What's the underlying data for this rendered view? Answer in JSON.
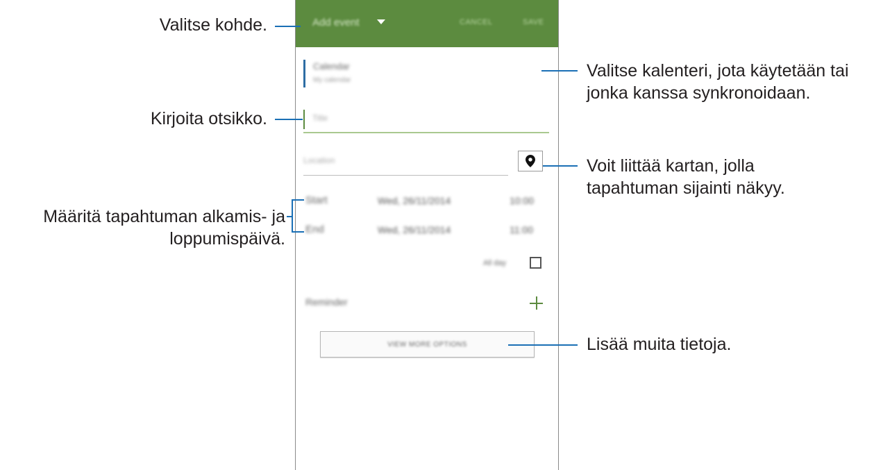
{
  "screen": {
    "app_bar": {
      "title": "Add event",
      "cancel_label": "CANCEL",
      "save_label": "SAVE",
      "color": "#5c8b3f"
    },
    "calendar": {
      "label": "Calendar",
      "value": "My calendar"
    },
    "title_field": {
      "placeholder": "Title"
    },
    "location_field": {
      "placeholder": "Location"
    },
    "start": {
      "label": "Start",
      "date": "Wed, 26/11/2014",
      "time": "10:00"
    },
    "end": {
      "label": "End",
      "date": "Wed, 26/11/2014",
      "time": "11:00"
    },
    "all_day_label": "All day",
    "reminder_label": "Reminder",
    "view_more_label": "VIEW MORE OPTIONS"
  },
  "callouts": {
    "select_item": "Valitse kohde.",
    "enter_title": "Kirjoita otsikko.",
    "set_dates_line1": "Määritä tapahtuman alkamis- ja",
    "set_dates_line2": "loppumispäivä.",
    "select_calendar_line1": "Valitse kalenteri, jota käytetään tai",
    "select_calendar_line2": "jonka kanssa synkronoidaan.",
    "attach_map_line1": "Voit liittää kartan, jolla",
    "attach_map_line2": "tapahtuman sijainti näkyy.",
    "add_details": "Lisää muita tietoja."
  },
  "colors": {
    "callout_line": "#1a6fb5",
    "accent": "#5c8b3f"
  }
}
